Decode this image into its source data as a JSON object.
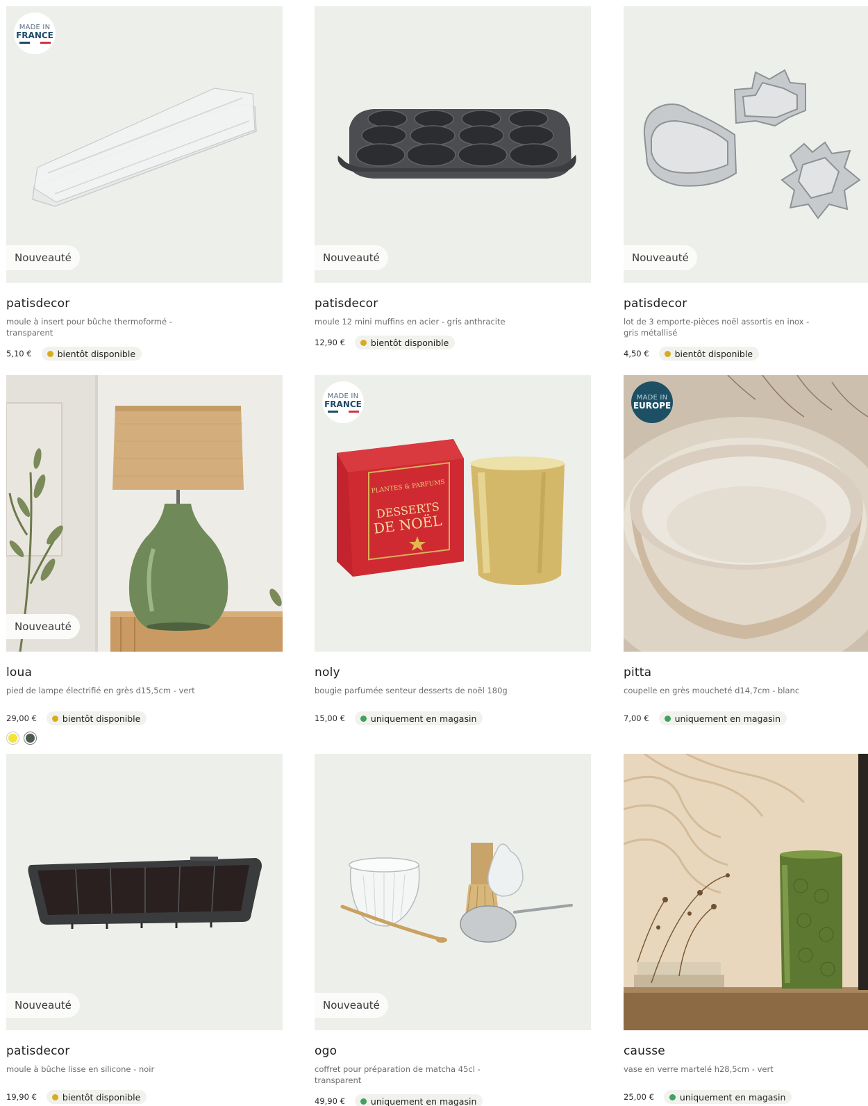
{
  "new_label": "Nouveauté",
  "made_in": {
    "france": {
      "line1": "MADE IN",
      "line2": "FRANCE"
    },
    "europe": {
      "line1": "MADE IN",
      "line2": "EUROPE"
    }
  },
  "colors": {
    "soon": "#d8ac1c",
    "store": "#3fa35a",
    "card_bg": "#edefeb"
  },
  "products": [
    {
      "brand": "patisdecor",
      "desc": "moule à insert pour bûche thermoformé - transparent",
      "price": "5,10 €",
      "status": "bientôt disponible",
      "status_type": "soon",
      "is_new": true,
      "made_in": "france",
      "icon": "bar-mold-image"
    },
    {
      "brand": "patisdecor",
      "desc": "moule 12 mini muffins en acier - gris anthracite",
      "price": "12,90 €",
      "status": "bientôt disponible",
      "status_type": "soon",
      "is_new": true,
      "icon": "muffin-tray-image"
    },
    {
      "brand": "patisdecor",
      "desc": "lot de 3 emporte-pièces noël assortis en inox - gris métallisé",
      "price": "4,50 €",
      "status": "bientôt disponible",
      "status_type": "soon",
      "is_new": true,
      "icon": "cookie-cutters-image"
    },
    {
      "brand": "loua",
      "desc": "pied de lampe électrifié en grès d15,5cm - vert",
      "price": "29,00 €",
      "status": "bientôt disponible",
      "status_type": "soon",
      "is_new": true,
      "swatches": [
        "#f3e33a",
        "#4c5a4f"
      ],
      "icon": "table-lamp-image"
    },
    {
      "brand": "noly",
      "desc": "bougie parfumée senteur desserts de noël 180g",
      "price": "15,00 €",
      "status": "uniquement en magasin",
      "status_type": "store",
      "made_in": "france",
      "icon": "candle-image",
      "box_text": {
        "line1": "PLANTES & PARFUMS",
        "line2": "DESSERTS",
        "line3": "DE NOËL"
      }
    },
    {
      "brand": "pitta",
      "desc": "coupelle en grès moucheté d14,7cm - blanc",
      "price": "7,00 €",
      "status": "uniquement en magasin",
      "status_type": "store",
      "made_in": "europe",
      "icon": "bowl-image"
    },
    {
      "brand": "patisdecor",
      "desc": "moule à bûche lisse en silicone - noir",
      "price": "19,90 €",
      "status": "bientôt disponible",
      "status_type": "soon",
      "is_new": true,
      "icon": "log-mold-image"
    },
    {
      "brand": "ogo",
      "desc": "coffret pour préparation de matcha 45cl - transparent",
      "price": "49,90 €",
      "status": "uniquement en magasin",
      "status_type": "store",
      "is_new": true,
      "icon": "matcha-set-image"
    },
    {
      "brand": "causse",
      "desc": "vase en verre martelé h28,5cm - vert",
      "price": "25,00 €",
      "status": "uniquement en magasin",
      "status_type": "store",
      "icon": "vase-image"
    }
  ]
}
